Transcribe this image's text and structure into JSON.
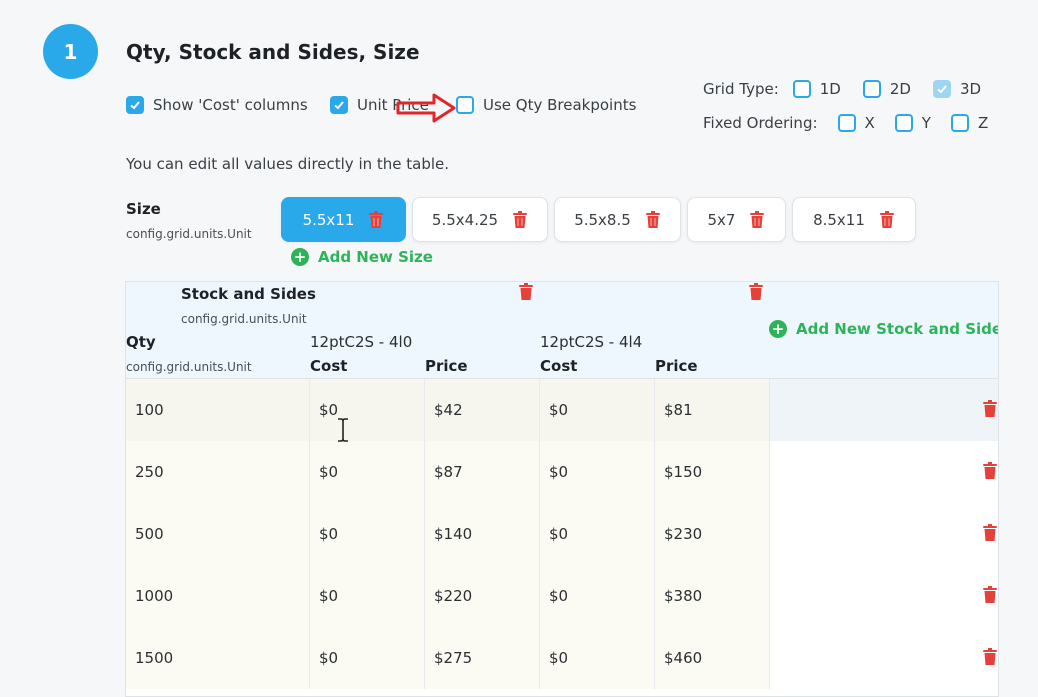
{
  "step": {
    "number": "1",
    "title": "Qty, Stock and Sides, Size"
  },
  "options": {
    "show_cost_columns": {
      "label": "Show 'Cost' columns",
      "checked": true
    },
    "unit_price": {
      "label": "Unit Price",
      "checked": true
    },
    "use_qty_breakpoints": {
      "label": "Use Qty Breakpoints",
      "checked": false
    }
  },
  "grid_type": {
    "label": "Grid Type:",
    "options": [
      {
        "label": "1D",
        "checked": false
      },
      {
        "label": "2D",
        "checked": false
      },
      {
        "label": "3D",
        "checked": true
      }
    ]
  },
  "fixed_ordering": {
    "label": "Fixed Ordering:",
    "options": [
      {
        "label": "X",
        "checked": false
      },
      {
        "label": "Y",
        "checked": false
      },
      {
        "label": "Z",
        "checked": false
      }
    ]
  },
  "description": "You can edit all values directly in the table.",
  "size": {
    "label": "Size",
    "sub": "config.grid.units.Unit",
    "tabs": [
      {
        "label": "5.5x11",
        "active": true
      },
      {
        "label": "5.5x4.25",
        "active": false
      },
      {
        "label": "5.5x8.5",
        "active": false
      },
      {
        "label": "5x7",
        "active": false
      },
      {
        "label": "8.5x11",
        "active": false
      }
    ],
    "add_label": "Add New Size"
  },
  "table": {
    "stock_label": "Stock and Sides",
    "stock_sub": "config.grid.units.Unit",
    "qty_label": "Qty",
    "qty_sub": "config.grid.units.Unit",
    "add_stock_label": "Add New Stock and Sides",
    "groups": [
      {
        "name": "12ptC2S - 4l0",
        "cost_label": "Cost",
        "price_label": "Price"
      },
      {
        "name": "12ptC2S - 4l4",
        "cost_label": "Cost",
        "price_label": "Price"
      }
    ],
    "rows": [
      {
        "qty": "100",
        "cost1": "$0",
        "price1": "$42",
        "cost2": "$0",
        "price2": "$81"
      },
      {
        "qty": "250",
        "cost1": "$0",
        "price1": "$87",
        "cost2": "$0",
        "price2": "$150"
      },
      {
        "qty": "500",
        "cost1": "$0",
        "price1": "$140",
        "cost2": "$0",
        "price2": "$230"
      },
      {
        "qty": "1000",
        "cost1": "$0",
        "price1": "$220",
        "cost2": "$0",
        "price2": "$380"
      },
      {
        "qty": "1500",
        "cost1": "$0",
        "price1": "$275",
        "cost2": "$0",
        "price2": "$460"
      }
    ]
  },
  "colors": {
    "accent": "#29a9e9",
    "add": "#2fb35a",
    "delete": "#e5403a",
    "annotation": "#e0262a"
  }
}
